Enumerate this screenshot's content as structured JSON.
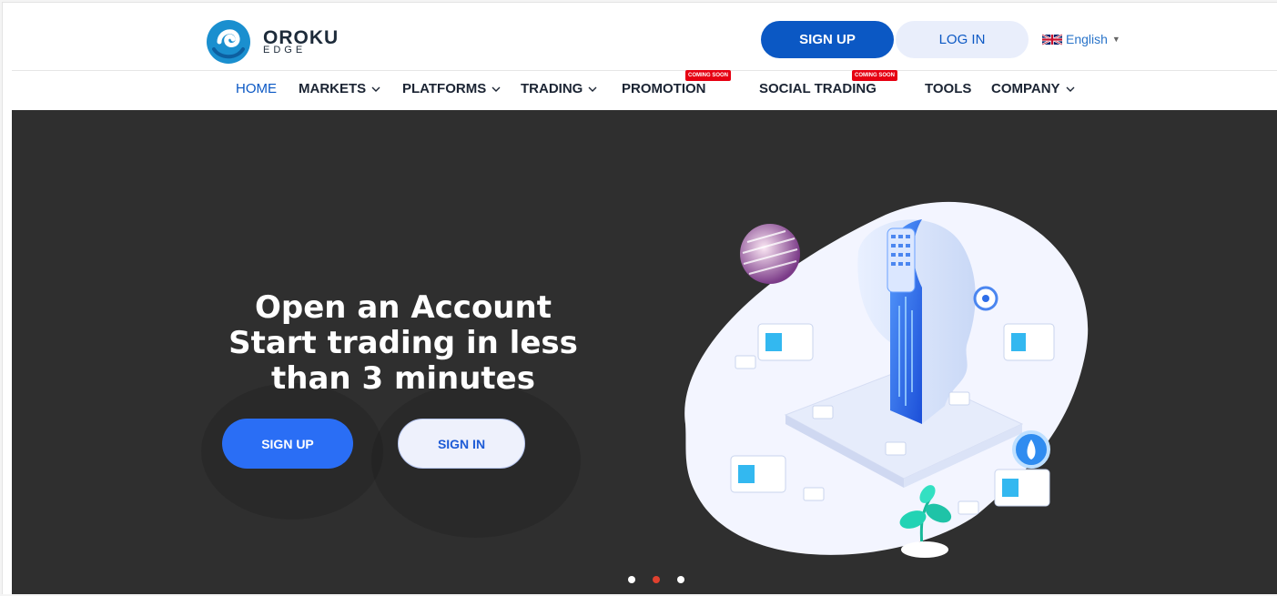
{
  "brand": {
    "name": "OROKU",
    "sub": "EDGE",
    "color": "#1a8fcf"
  },
  "header": {
    "signup_label": "SIGN UP",
    "login_label": "LOG IN",
    "language": "English"
  },
  "nav": {
    "items": [
      {
        "label": "HOME",
        "dropdown": false,
        "active": true
      },
      {
        "label": "MARKETS",
        "dropdown": true
      },
      {
        "label": "PLATFORMS",
        "dropdown": true
      },
      {
        "label": "TRADING",
        "dropdown": true
      },
      {
        "label": "PROMOTION",
        "dropdown": false,
        "badge": "COMING SOON"
      },
      {
        "label": "SOCIAL TRADING",
        "dropdown": false,
        "badge": "COMING SOON"
      },
      {
        "label": "TOOLS",
        "dropdown": false
      },
      {
        "label": "COMPANY",
        "dropdown": true
      }
    ]
  },
  "hero": {
    "headline": "Open an Account Start trading in less than 3 minutes",
    "signup_label": "SIGN UP",
    "signin_label": "SIGN IN",
    "slides": {
      "count": 3,
      "active_index": 1
    }
  },
  "colors": {
    "primary": "#0b58c4",
    "hero_bg": "#2f2f2f",
    "hero_button": "#2a6ef5",
    "badge": "#e60012",
    "active_dot": "#e0412f"
  }
}
